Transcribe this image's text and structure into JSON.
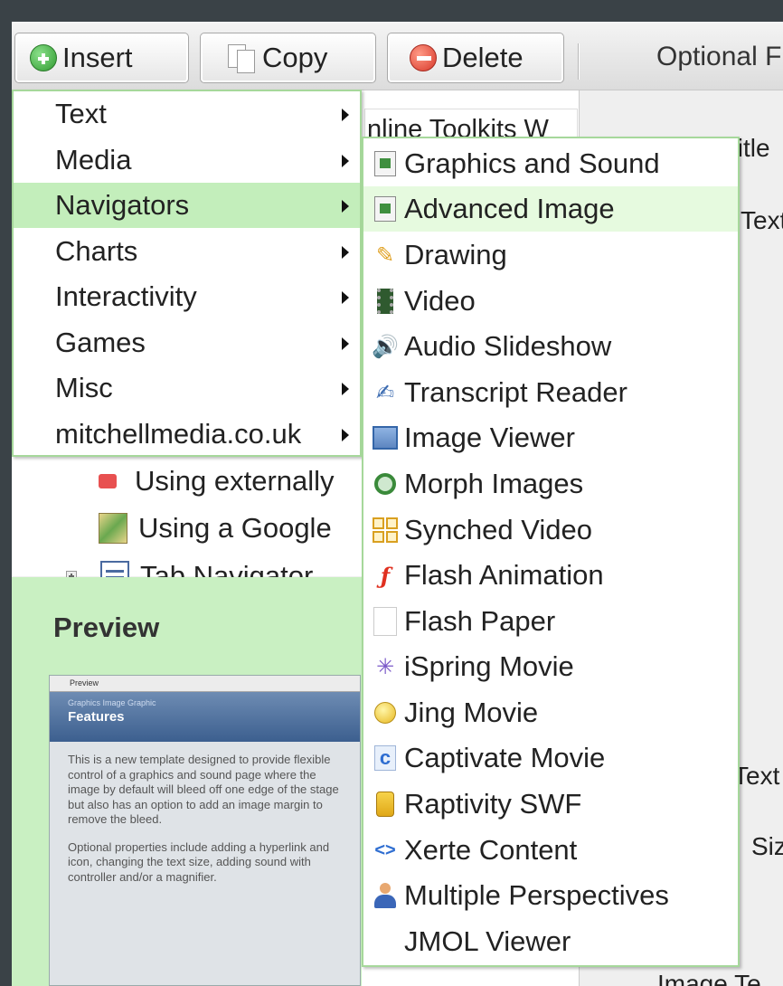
{
  "toolbar": {
    "insert_label": "Insert",
    "copy_label": "Copy",
    "delete_label": "Delete",
    "optional_label": "Optional F"
  },
  "center": {
    "text": "nline Toolkits W"
  },
  "tree": {
    "partial_item": "Using externally",
    "google_item": "Using a Google",
    "tab_navigator": "Tab Navigator"
  },
  "preview": {
    "title": "Preview",
    "thumb_window": "Preview",
    "thumb_sub": "Graphics Image Graphic",
    "thumb_title": "Features",
    "thumb_p1": "This is a new template designed to provide flexible control of a graphics and sound page where the image by default will bleed off one edge of the stage but also has an option to add an image margin to remove the bleed.",
    "thumb_p2": "Optional properties include adding a hyperlink and icon, changing the text size, adding sound with controller and/or a magnifier."
  },
  "right": {
    "page_title": "Page Title",
    "text1": "Text",
    "text2": "Text",
    "size": "Siz",
    "image_t": "Image Te"
  },
  "menu_main": {
    "items": [
      {
        "label": "Text"
      },
      {
        "label": "Media"
      },
      {
        "label": "Navigators"
      },
      {
        "label": "Charts"
      },
      {
        "label": "Interactivity"
      },
      {
        "label": "Games"
      },
      {
        "label": "Misc"
      },
      {
        "label": "mitchellmedia.co.uk"
      }
    ],
    "highlighted": "Navigators"
  },
  "submenu": {
    "items": [
      {
        "label": "Graphics and Sound",
        "icon": "page-image-icon"
      },
      {
        "label": "Advanced Image",
        "icon": "page-image-icon"
      },
      {
        "label": "Drawing",
        "icon": "pencil-icon"
      },
      {
        "label": "Video",
        "icon": "film-icon"
      },
      {
        "label": "Audio Slideshow",
        "icon": "speaker-icon"
      },
      {
        "label": "Transcript Reader",
        "icon": "quill-icon"
      },
      {
        "label": "Image Viewer",
        "icon": "window-icon"
      },
      {
        "label": "Morph Images",
        "icon": "magnifier-icon"
      },
      {
        "label": "Synched Video",
        "icon": "grid-icon"
      },
      {
        "label": "Flash Animation",
        "icon": "flash-icon"
      },
      {
        "label": "Flash Paper",
        "icon": "blank-page-icon"
      },
      {
        "label": "iSpring Movie",
        "icon": "spark-icon"
      },
      {
        "label": "Jing Movie",
        "icon": "bulb-icon"
      },
      {
        "label": "Captivate Movie",
        "icon": "captivate-icon"
      },
      {
        "label": "Raptivity SWF",
        "icon": "jar-icon"
      },
      {
        "label": "Xerte Content",
        "icon": "code-icon"
      },
      {
        "label": "Multiple Perspectives",
        "icon": "person-icon"
      },
      {
        "label": "JMOL Viewer",
        "icon": ""
      }
    ],
    "highlighted": "Advanced Image"
  },
  "colors": {
    "menu_border": "#a6d89b",
    "highlight": "#c3eebb",
    "panel_green": "#c9f0c2",
    "frame": "#3a4247"
  }
}
